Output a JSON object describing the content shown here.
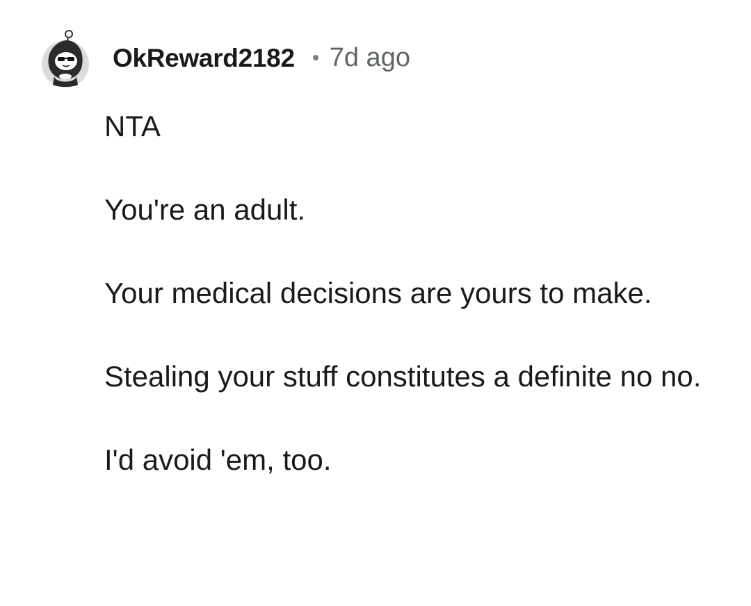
{
  "comment": {
    "username": "OkReward2182",
    "timestamp": "7d ago",
    "avatar_icon": "snoo-avatar-icon",
    "paragraphs": [
      "NTA",
      "You're an adult.",
      "Your medical decisions are yours to make.",
      "Stealing your stuff constitutes a definite no no.",
      "I'd avoid 'em, too."
    ]
  },
  "colors": {
    "text": "#1a1a1b",
    "meta": "#5f6467",
    "background": "#ffffff"
  }
}
